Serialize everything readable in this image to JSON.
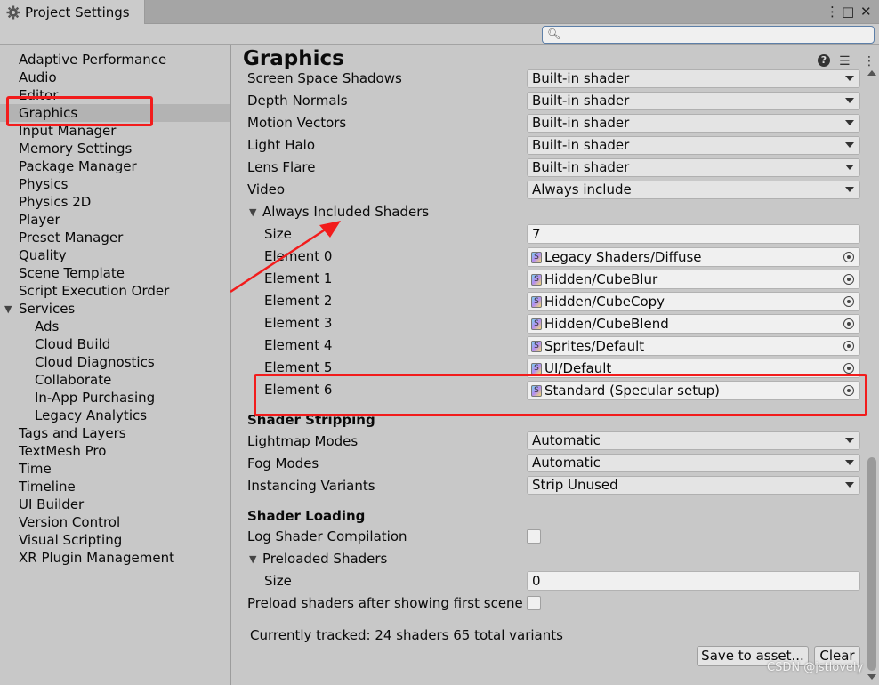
{
  "window": {
    "tab_title": "Project Settings",
    "controls": [
      "⋮",
      "□",
      "✕"
    ]
  },
  "search": {
    "placeholder": ""
  },
  "sidebar": {
    "items": [
      {
        "label": "Adaptive Performance"
      },
      {
        "label": "Audio"
      },
      {
        "label": "Editor"
      },
      {
        "label": "Graphics",
        "selected": true
      },
      {
        "label": "Input Manager"
      },
      {
        "label": "Memory Settings"
      },
      {
        "label": "Package Manager"
      },
      {
        "label": "Physics"
      },
      {
        "label": "Physics 2D"
      },
      {
        "label": "Player"
      },
      {
        "label": "Preset Manager"
      },
      {
        "label": "Quality"
      },
      {
        "label": "Scene Template"
      },
      {
        "label": "Script Execution Order"
      },
      {
        "label": "Services",
        "expanded": true
      },
      {
        "label": "Ads"
      },
      {
        "label": "Cloud Build"
      },
      {
        "label": "Cloud Diagnostics"
      },
      {
        "label": "Collaborate"
      },
      {
        "label": "In-App Purchasing"
      },
      {
        "label": "Legacy Analytics"
      },
      {
        "label": "Tags and Layers"
      },
      {
        "label": "TextMesh Pro"
      },
      {
        "label": "Time"
      },
      {
        "label": "Timeline"
      },
      {
        "label": "UI Builder"
      },
      {
        "label": "Version Control"
      },
      {
        "label": "Visual Scripting"
      },
      {
        "label": "XR Plugin Management"
      }
    ]
  },
  "main": {
    "title": "Graphics",
    "header_icons": [
      "help-icon",
      "presets-icon",
      "more-icon"
    ],
    "builtin_rows": [
      {
        "label": "Screen Space Shadows",
        "value": "Built-in shader"
      },
      {
        "label": "Depth Normals",
        "value": "Built-in shader"
      },
      {
        "label": "Motion Vectors",
        "value": "Built-in shader"
      },
      {
        "label": "Light Halo",
        "value": "Built-in shader"
      },
      {
        "label": "Lens Flare",
        "value": "Built-in shader"
      },
      {
        "label": "Video",
        "value": "Always include"
      }
    ],
    "always_included": {
      "label": "Always Included Shaders",
      "size_label": "Size",
      "size_value": "7",
      "elements": [
        {
          "label": "Element 0",
          "value": "Legacy Shaders/Diffuse"
        },
        {
          "label": "Element 1",
          "value": "Hidden/CubeBlur"
        },
        {
          "label": "Element 2",
          "value": "Hidden/CubeCopy"
        },
        {
          "label": "Element 3",
          "value": "Hidden/CubeBlend"
        },
        {
          "label": "Element 4",
          "value": "Sprites/Default"
        },
        {
          "label": "Element 5",
          "value": "UI/Default"
        },
        {
          "label": "Element 6",
          "value": "Standard (Specular setup)"
        }
      ]
    },
    "shader_stripping": {
      "heading": "Shader Stripping",
      "rows": [
        {
          "label": "Lightmap Modes",
          "value": "Automatic"
        },
        {
          "label": "Fog Modes",
          "value": "Automatic"
        },
        {
          "label": "Instancing Variants",
          "value": "Strip Unused"
        }
      ]
    },
    "shader_loading": {
      "heading": "Shader Loading",
      "log_label": "Log Shader Compilation",
      "log_checked": false,
      "preloaded_label": "Preloaded Shaders",
      "size_label": "Size",
      "size_value": "0",
      "preload_after_label": "Preload shaders after showing first scene",
      "preload_after_checked": false
    },
    "status": "Currently tracked: 24 shaders 65 total variants",
    "save_button": "Save to asset...",
    "clear_button": "Clear"
  },
  "watermark": "CSDN @jstlovely",
  "annotation_color": "#f21c1c"
}
